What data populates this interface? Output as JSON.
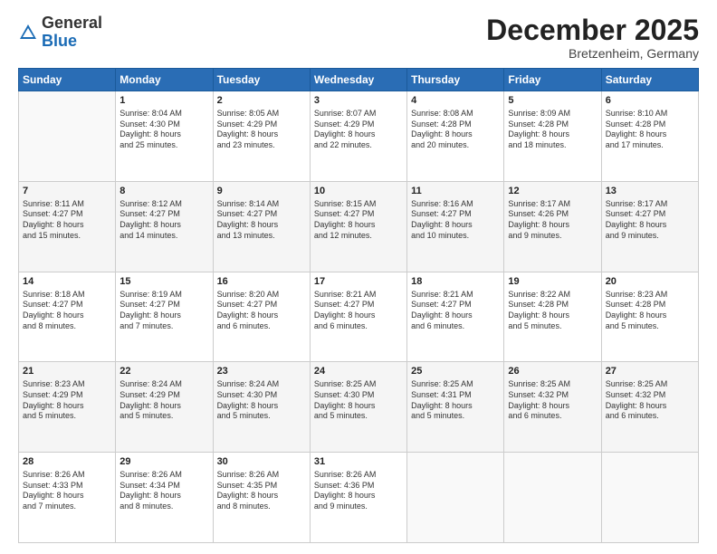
{
  "logo": {
    "general": "General",
    "blue": "Blue"
  },
  "title": "December 2025",
  "subtitle": "Bretzenheim, Germany",
  "days_header": [
    "Sunday",
    "Monday",
    "Tuesday",
    "Wednesday",
    "Thursday",
    "Friday",
    "Saturday"
  ],
  "weeks": [
    [
      {
        "num": "",
        "info": ""
      },
      {
        "num": "1",
        "info": "Sunrise: 8:04 AM\nSunset: 4:30 PM\nDaylight: 8 hours\nand 25 minutes."
      },
      {
        "num": "2",
        "info": "Sunrise: 8:05 AM\nSunset: 4:29 PM\nDaylight: 8 hours\nand 23 minutes."
      },
      {
        "num": "3",
        "info": "Sunrise: 8:07 AM\nSunset: 4:29 PM\nDaylight: 8 hours\nand 22 minutes."
      },
      {
        "num": "4",
        "info": "Sunrise: 8:08 AM\nSunset: 4:28 PM\nDaylight: 8 hours\nand 20 minutes."
      },
      {
        "num": "5",
        "info": "Sunrise: 8:09 AM\nSunset: 4:28 PM\nDaylight: 8 hours\nand 18 minutes."
      },
      {
        "num": "6",
        "info": "Sunrise: 8:10 AM\nSunset: 4:28 PM\nDaylight: 8 hours\nand 17 minutes."
      }
    ],
    [
      {
        "num": "7",
        "info": "Sunrise: 8:11 AM\nSunset: 4:27 PM\nDaylight: 8 hours\nand 15 minutes."
      },
      {
        "num": "8",
        "info": "Sunrise: 8:12 AM\nSunset: 4:27 PM\nDaylight: 8 hours\nand 14 minutes."
      },
      {
        "num": "9",
        "info": "Sunrise: 8:14 AM\nSunset: 4:27 PM\nDaylight: 8 hours\nand 13 minutes."
      },
      {
        "num": "10",
        "info": "Sunrise: 8:15 AM\nSunset: 4:27 PM\nDaylight: 8 hours\nand 12 minutes."
      },
      {
        "num": "11",
        "info": "Sunrise: 8:16 AM\nSunset: 4:27 PM\nDaylight: 8 hours\nand 10 minutes."
      },
      {
        "num": "12",
        "info": "Sunrise: 8:17 AM\nSunset: 4:26 PM\nDaylight: 8 hours\nand 9 minutes."
      },
      {
        "num": "13",
        "info": "Sunrise: 8:17 AM\nSunset: 4:27 PM\nDaylight: 8 hours\nand 9 minutes."
      }
    ],
    [
      {
        "num": "14",
        "info": "Sunrise: 8:18 AM\nSunset: 4:27 PM\nDaylight: 8 hours\nand 8 minutes."
      },
      {
        "num": "15",
        "info": "Sunrise: 8:19 AM\nSunset: 4:27 PM\nDaylight: 8 hours\nand 7 minutes."
      },
      {
        "num": "16",
        "info": "Sunrise: 8:20 AM\nSunset: 4:27 PM\nDaylight: 8 hours\nand 6 minutes."
      },
      {
        "num": "17",
        "info": "Sunrise: 8:21 AM\nSunset: 4:27 PM\nDaylight: 8 hours\nand 6 minutes."
      },
      {
        "num": "18",
        "info": "Sunrise: 8:21 AM\nSunset: 4:27 PM\nDaylight: 8 hours\nand 6 minutes."
      },
      {
        "num": "19",
        "info": "Sunrise: 8:22 AM\nSunset: 4:28 PM\nDaylight: 8 hours\nand 5 minutes."
      },
      {
        "num": "20",
        "info": "Sunrise: 8:23 AM\nSunset: 4:28 PM\nDaylight: 8 hours\nand 5 minutes."
      }
    ],
    [
      {
        "num": "21",
        "info": "Sunrise: 8:23 AM\nSunset: 4:29 PM\nDaylight: 8 hours\nand 5 minutes."
      },
      {
        "num": "22",
        "info": "Sunrise: 8:24 AM\nSunset: 4:29 PM\nDaylight: 8 hours\nand 5 minutes."
      },
      {
        "num": "23",
        "info": "Sunrise: 8:24 AM\nSunset: 4:30 PM\nDaylight: 8 hours\nand 5 minutes."
      },
      {
        "num": "24",
        "info": "Sunrise: 8:25 AM\nSunset: 4:30 PM\nDaylight: 8 hours\nand 5 minutes."
      },
      {
        "num": "25",
        "info": "Sunrise: 8:25 AM\nSunset: 4:31 PM\nDaylight: 8 hours\nand 5 minutes."
      },
      {
        "num": "26",
        "info": "Sunrise: 8:25 AM\nSunset: 4:32 PM\nDaylight: 8 hours\nand 6 minutes."
      },
      {
        "num": "27",
        "info": "Sunrise: 8:25 AM\nSunset: 4:32 PM\nDaylight: 8 hours\nand 6 minutes."
      }
    ],
    [
      {
        "num": "28",
        "info": "Sunrise: 8:26 AM\nSunset: 4:33 PM\nDaylight: 8 hours\nand 7 minutes."
      },
      {
        "num": "29",
        "info": "Sunrise: 8:26 AM\nSunset: 4:34 PM\nDaylight: 8 hours\nand 8 minutes."
      },
      {
        "num": "30",
        "info": "Sunrise: 8:26 AM\nSunset: 4:35 PM\nDaylight: 8 hours\nand 8 minutes."
      },
      {
        "num": "31",
        "info": "Sunrise: 8:26 AM\nSunset: 4:36 PM\nDaylight: 8 hours\nand 9 minutes."
      },
      {
        "num": "",
        "info": ""
      },
      {
        "num": "",
        "info": ""
      },
      {
        "num": "",
        "info": ""
      }
    ]
  ]
}
